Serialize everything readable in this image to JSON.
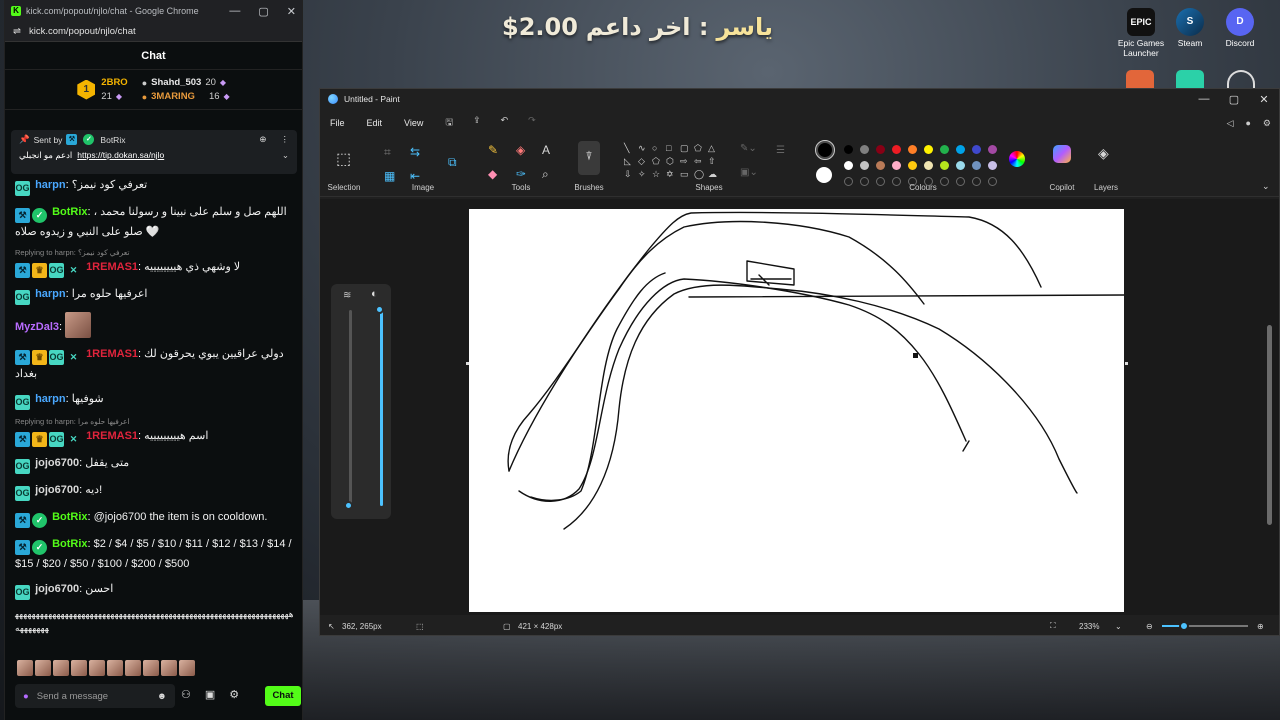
{
  "desktop": {
    "donation": {
      "name": "ياسر",
      "text": "اخر داعم :",
      "amount": "$2.00"
    },
    "icons": [
      {
        "label": "Epic Games Launcher",
        "glyph": "EPIC",
        "icon": "epic-games-icon"
      },
      {
        "label": "Steam",
        "glyph": "S",
        "icon": "steam-icon"
      },
      {
        "label": "Discord",
        "glyph": "D",
        "icon": "discord-icon"
      }
    ]
  },
  "chrome": {
    "title": "kick.com/popout/njlo/chat - Google Chrome",
    "url": "kick.com/popout/njlo/chat",
    "controls": [
      "—",
      "▢",
      "✕"
    ]
  },
  "chat": {
    "header": "Chat",
    "leaderboard": {
      "rank": "1",
      "first": {
        "name": "2BRO",
        "count": "21"
      },
      "second": {
        "name": "Shahd_503",
        "count": "20"
      },
      "third": {
        "name": "3MARING",
        "count": "16"
      }
    },
    "pinned": {
      "sent_by": "Sent by",
      "sender": "BotRix",
      "text": "ادعم مو انجبلي",
      "link": "https://tip.dokan.sa/njlo"
    },
    "messages": [
      {
        "user": "harpn",
        "text": "تعرفي كود نيمز؟"
      },
      {
        "user": "BotRix",
        "text": "اللهم صل و سلم على نبينا و رسولنا محمد ، صلو على النبي و زيدوه صلاه 🤍"
      },
      {
        "reply": "Replying to harpn: تعرفي كود نيمز؟",
        "user": "1REMAS1",
        "text": "لا وشهي ذي هييييييييه"
      },
      {
        "user": "harpn",
        "text": "اعرفيها حلوه مرا"
      },
      {
        "user": "MyzDal3",
        "text": ""
      },
      {
        "user": "1REMAS1",
        "text": "دولي عراقيين يبوي يحرقون لك بغداد"
      },
      {
        "user": "harpn",
        "text": "شوفيها"
      },
      {
        "reply": "Replying to harpn: اعرفيها حلوه مرا",
        "user": "1REMAS1",
        "text": "اسم هيييييييييه"
      },
      {
        "user": "jojo6700",
        "text": "متى يقفل"
      },
      {
        "user": "jojo6700",
        "text": "ديه!"
      },
      {
        "user": "BotRix",
        "text": "@jojo6700 the item is on cooldown."
      },
      {
        "user": "BotRix",
        "text": "$2 / $4 / $5 / $10 / $11 / $12 / $13 / $14 / $15 / $20 / $50 / $100 / $200 / $500"
      },
      {
        "user": "jojo6700",
        "text": "احسن"
      },
      {
        "user": "",
        "text": "ههههههههههههههههههههههههههههههههههههههههههههههههههههههههههههههههههههههههههه"
      }
    ],
    "input_placeholder": "Send a message",
    "send_label": "Chat"
  },
  "paint": {
    "title": "Untitled - Paint",
    "menu": [
      "File",
      "Edit",
      "View"
    ],
    "groups": {
      "selection": "Selection",
      "image": "Image",
      "tools": "Tools",
      "brushes": "Brushes",
      "shapes": "Shapes",
      "colours": "Colours",
      "copilot": "Copilot",
      "layers": "Layers"
    },
    "colors": {
      "row1": [
        "#000000",
        "#7f7f7f",
        "#880015",
        "#ed1c24",
        "#ff7f27",
        "#fff200",
        "#22b14c",
        "#00a2e8",
        "#3f48cc",
        "#a349a4"
      ],
      "row2": [
        "#ffffff",
        "#c3c3c3",
        "#b97a57",
        "#ffaec9",
        "#ffc90e",
        "#efe4b0",
        "#b5e61d",
        "#99d9ea",
        "#7092be",
        "#c8bfe7"
      ]
    },
    "status": {
      "cursor": "362, 265px",
      "canvas_size": "421 × 428px",
      "zoom": "233%",
      "zoom_fraction": 0.25
    },
    "sliders": {
      "size_fraction": 0.0,
      "opacity_fraction": 1.0
    }
  }
}
